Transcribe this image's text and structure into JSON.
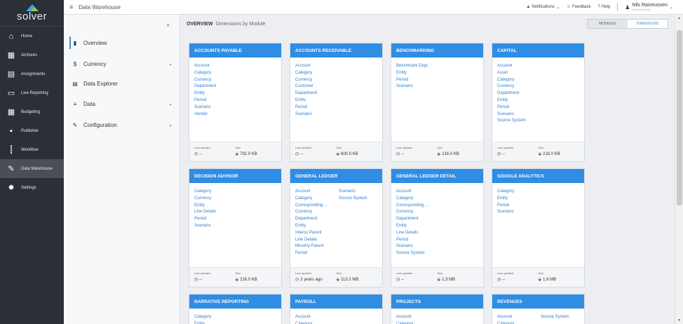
{
  "app": {
    "logo_text": "solver",
    "section_title": "Data Warehouse"
  },
  "topbar": {
    "notifications": "Notifications",
    "feedback": "Feedback",
    "help": "Help",
    "user_name": "Nils Rasmussen",
    "user_sub": "SolDest Martin"
  },
  "rail": [
    {
      "label": "Home",
      "icon": "home-icon"
    },
    {
      "label": "Archives",
      "icon": "archive-icon"
    },
    {
      "label": "Assignments",
      "icon": "clipboard-icon"
    },
    {
      "label": "Live Reporting",
      "icon": "report-icon"
    },
    {
      "label": "Budgeting",
      "icon": "calculator-icon"
    },
    {
      "label": "Publisher",
      "icon": "publisher-icon"
    },
    {
      "label": "Workflow",
      "icon": "workflow-icon"
    },
    {
      "label": "Data Warehouse",
      "icon": "wrench-icon"
    },
    {
      "label": "Settings",
      "icon": "gear-icon"
    }
  ],
  "panel": [
    {
      "label": "Overview",
      "icon": "book-icon"
    },
    {
      "label": "Currency",
      "icon": "dollar-icon"
    },
    {
      "label": "Data Explorer",
      "icon": "explorer-icon"
    },
    {
      "label": "Data",
      "icon": "database-icon"
    },
    {
      "label": "Configuration",
      "icon": "wrench-icon"
    }
  ],
  "header": {
    "title": "OVERVIEW",
    "subtitle": "Dimensions by Module",
    "toggle_modules": "MODULES",
    "toggle_dimensions": "DIMENSIONS"
  },
  "footer_labels": {
    "updated": "Last updated",
    "size": "Size"
  },
  "cards": [
    {
      "title": "ACCOUNTS PAYABLE",
      "col1": [
        "Account",
        "Category",
        "Currency",
        "Department",
        "Entity",
        "Period",
        "Scenario",
        "Vendor"
      ],
      "col2": [],
      "updated": "--",
      "size": "792.0 KB"
    },
    {
      "title": "ACCOUNTS RECEIVABLE",
      "col1": [
        "Account",
        "Category",
        "Currency",
        "Customer",
        "Department",
        "Entity",
        "Period",
        "Scenario"
      ],
      "col2": [],
      "updated": "--",
      "size": "600.0 KB"
    },
    {
      "title": "BENCHMARKING",
      "col1": [
        "Benchmark Orgs",
        "Entity",
        "Period",
        "Scenario"
      ],
      "col2": [],
      "updated": "--",
      "size": "216.0 KB"
    },
    {
      "title": "CAPITAL",
      "col1": [
        "Account",
        "Asset",
        "Category",
        "Currency",
        "Department",
        "Entity",
        "Period",
        "Scenario",
        "Source System"
      ],
      "col2": [],
      "updated": "--",
      "size": "216.0 KB"
    },
    {
      "title": "DECISION ADVISOR",
      "col1": [
        "Category",
        "Currency",
        "Entity",
        "Line Details",
        "Period",
        "Scenario"
      ],
      "col2": [],
      "updated": "--",
      "size": "216.0 KB"
    },
    {
      "title": "GENERAL LEDGER",
      "col1": [
        "Account",
        "Category",
        "Corresponding ...",
        "Currency",
        "Department",
        "Entity",
        "Interco Parent",
        "Line Details",
        "Minority Parent",
        "Period"
      ],
      "col2": [
        "Scenario",
        "Source System"
      ],
      "updated": "2 years ago",
      "size": "113.2 MB"
    },
    {
      "title": "GENERAL LEDGER DETAIL",
      "col1": [
        "Account",
        "Category",
        "Corresponding ...",
        "Currency",
        "Department",
        "Entity",
        "Line Details",
        "Period",
        "Scenario",
        "Source System"
      ],
      "col2": [],
      "updated": "--",
      "size": "1.3 MB"
    },
    {
      "title": "GOOGLE ANALYTICS",
      "col1": [
        "Category",
        "Entity",
        "Period",
        "Scenario"
      ],
      "col2": [],
      "updated": "--",
      "size": "1.9 MB"
    },
    {
      "title": "NARRATIVE REPORTING",
      "col1": [
        "Category",
        "Entity"
      ],
      "col2": [],
      "updated": "",
      "size": ""
    },
    {
      "title": "PAYROLL",
      "col1": [
        "Account",
        "Category"
      ],
      "col2": [],
      "updated": "",
      "size": ""
    },
    {
      "title": "PROJECTS",
      "col1": [
        "Account",
        "Category"
      ],
      "col2": [],
      "updated": "",
      "size": ""
    },
    {
      "title": "REVENUES",
      "col1": [
        "Account",
        "Category"
      ],
      "col2": [
        "Source System"
      ],
      "updated": "",
      "size": ""
    }
  ]
}
